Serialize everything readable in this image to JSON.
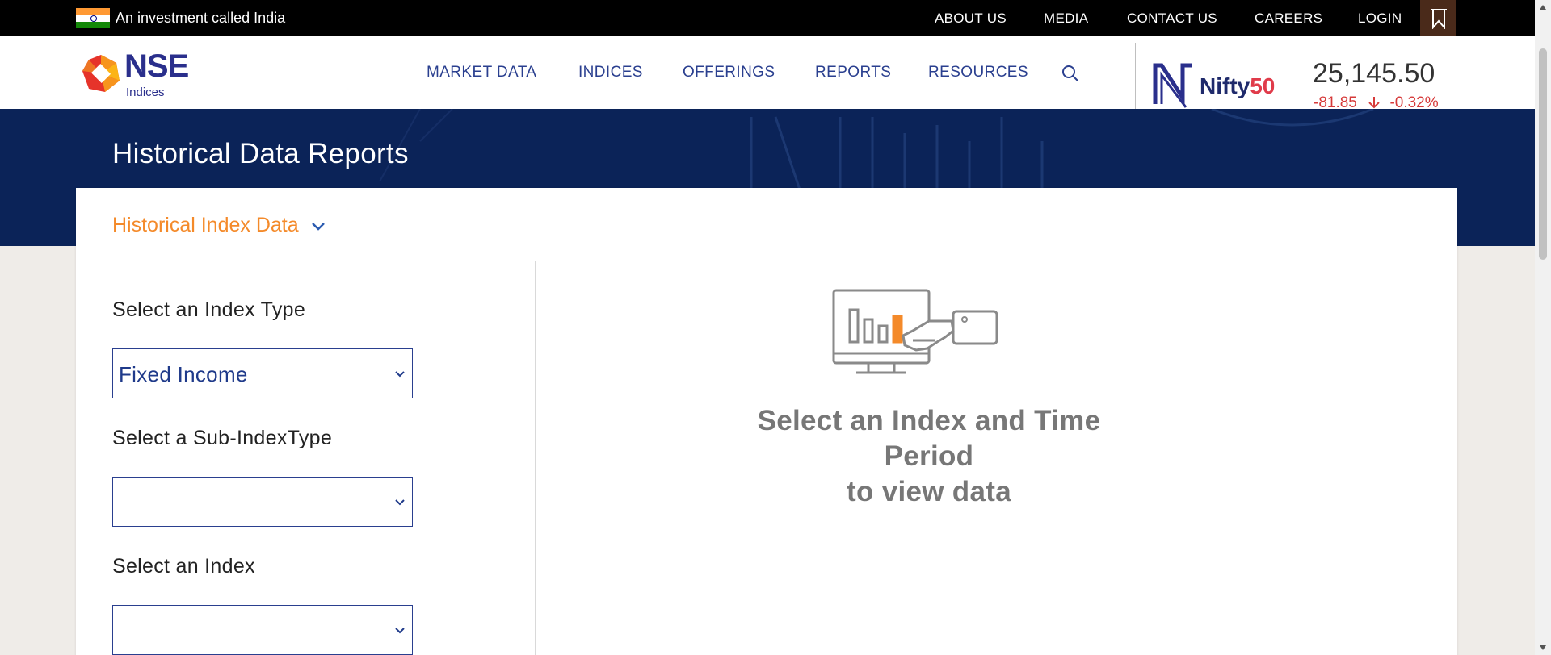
{
  "topbar": {
    "tagline": "An investment called India",
    "links": [
      "ABOUT US",
      "MEDIA",
      "CONTACT US",
      "CAREERS",
      "LOGIN"
    ]
  },
  "logo": {
    "name": "NSE",
    "sub": "Indices"
  },
  "nav": {
    "items": [
      "MARKET DATA",
      "INDICES",
      "OFFERINGS",
      "REPORTS",
      "RESOURCES"
    ]
  },
  "ticker": {
    "brand_word": "Nifty",
    "brand_num": "50",
    "value": "25,145.50",
    "change": "-81.85",
    "change_pct": "-0.32%",
    "change_color": "#d63a3a"
  },
  "banner": {
    "title": "Historical Data Reports"
  },
  "card": {
    "dropdown_label": "Historical Index Data",
    "fields": [
      {
        "label": "Select an Index Type",
        "value": "Fixed Income"
      },
      {
        "label": "Select a Sub-IndexType",
        "value": ""
      },
      {
        "label": "Select an Index",
        "value": ""
      }
    ],
    "empty_text_line1": "Select an Index and Time Period",
    "empty_text_line2": "to view data"
  },
  "colors": {
    "accent_orange": "#f48a2a",
    "brand_blue": "#2a3f8f",
    "banner_navy": "#0b2358"
  }
}
